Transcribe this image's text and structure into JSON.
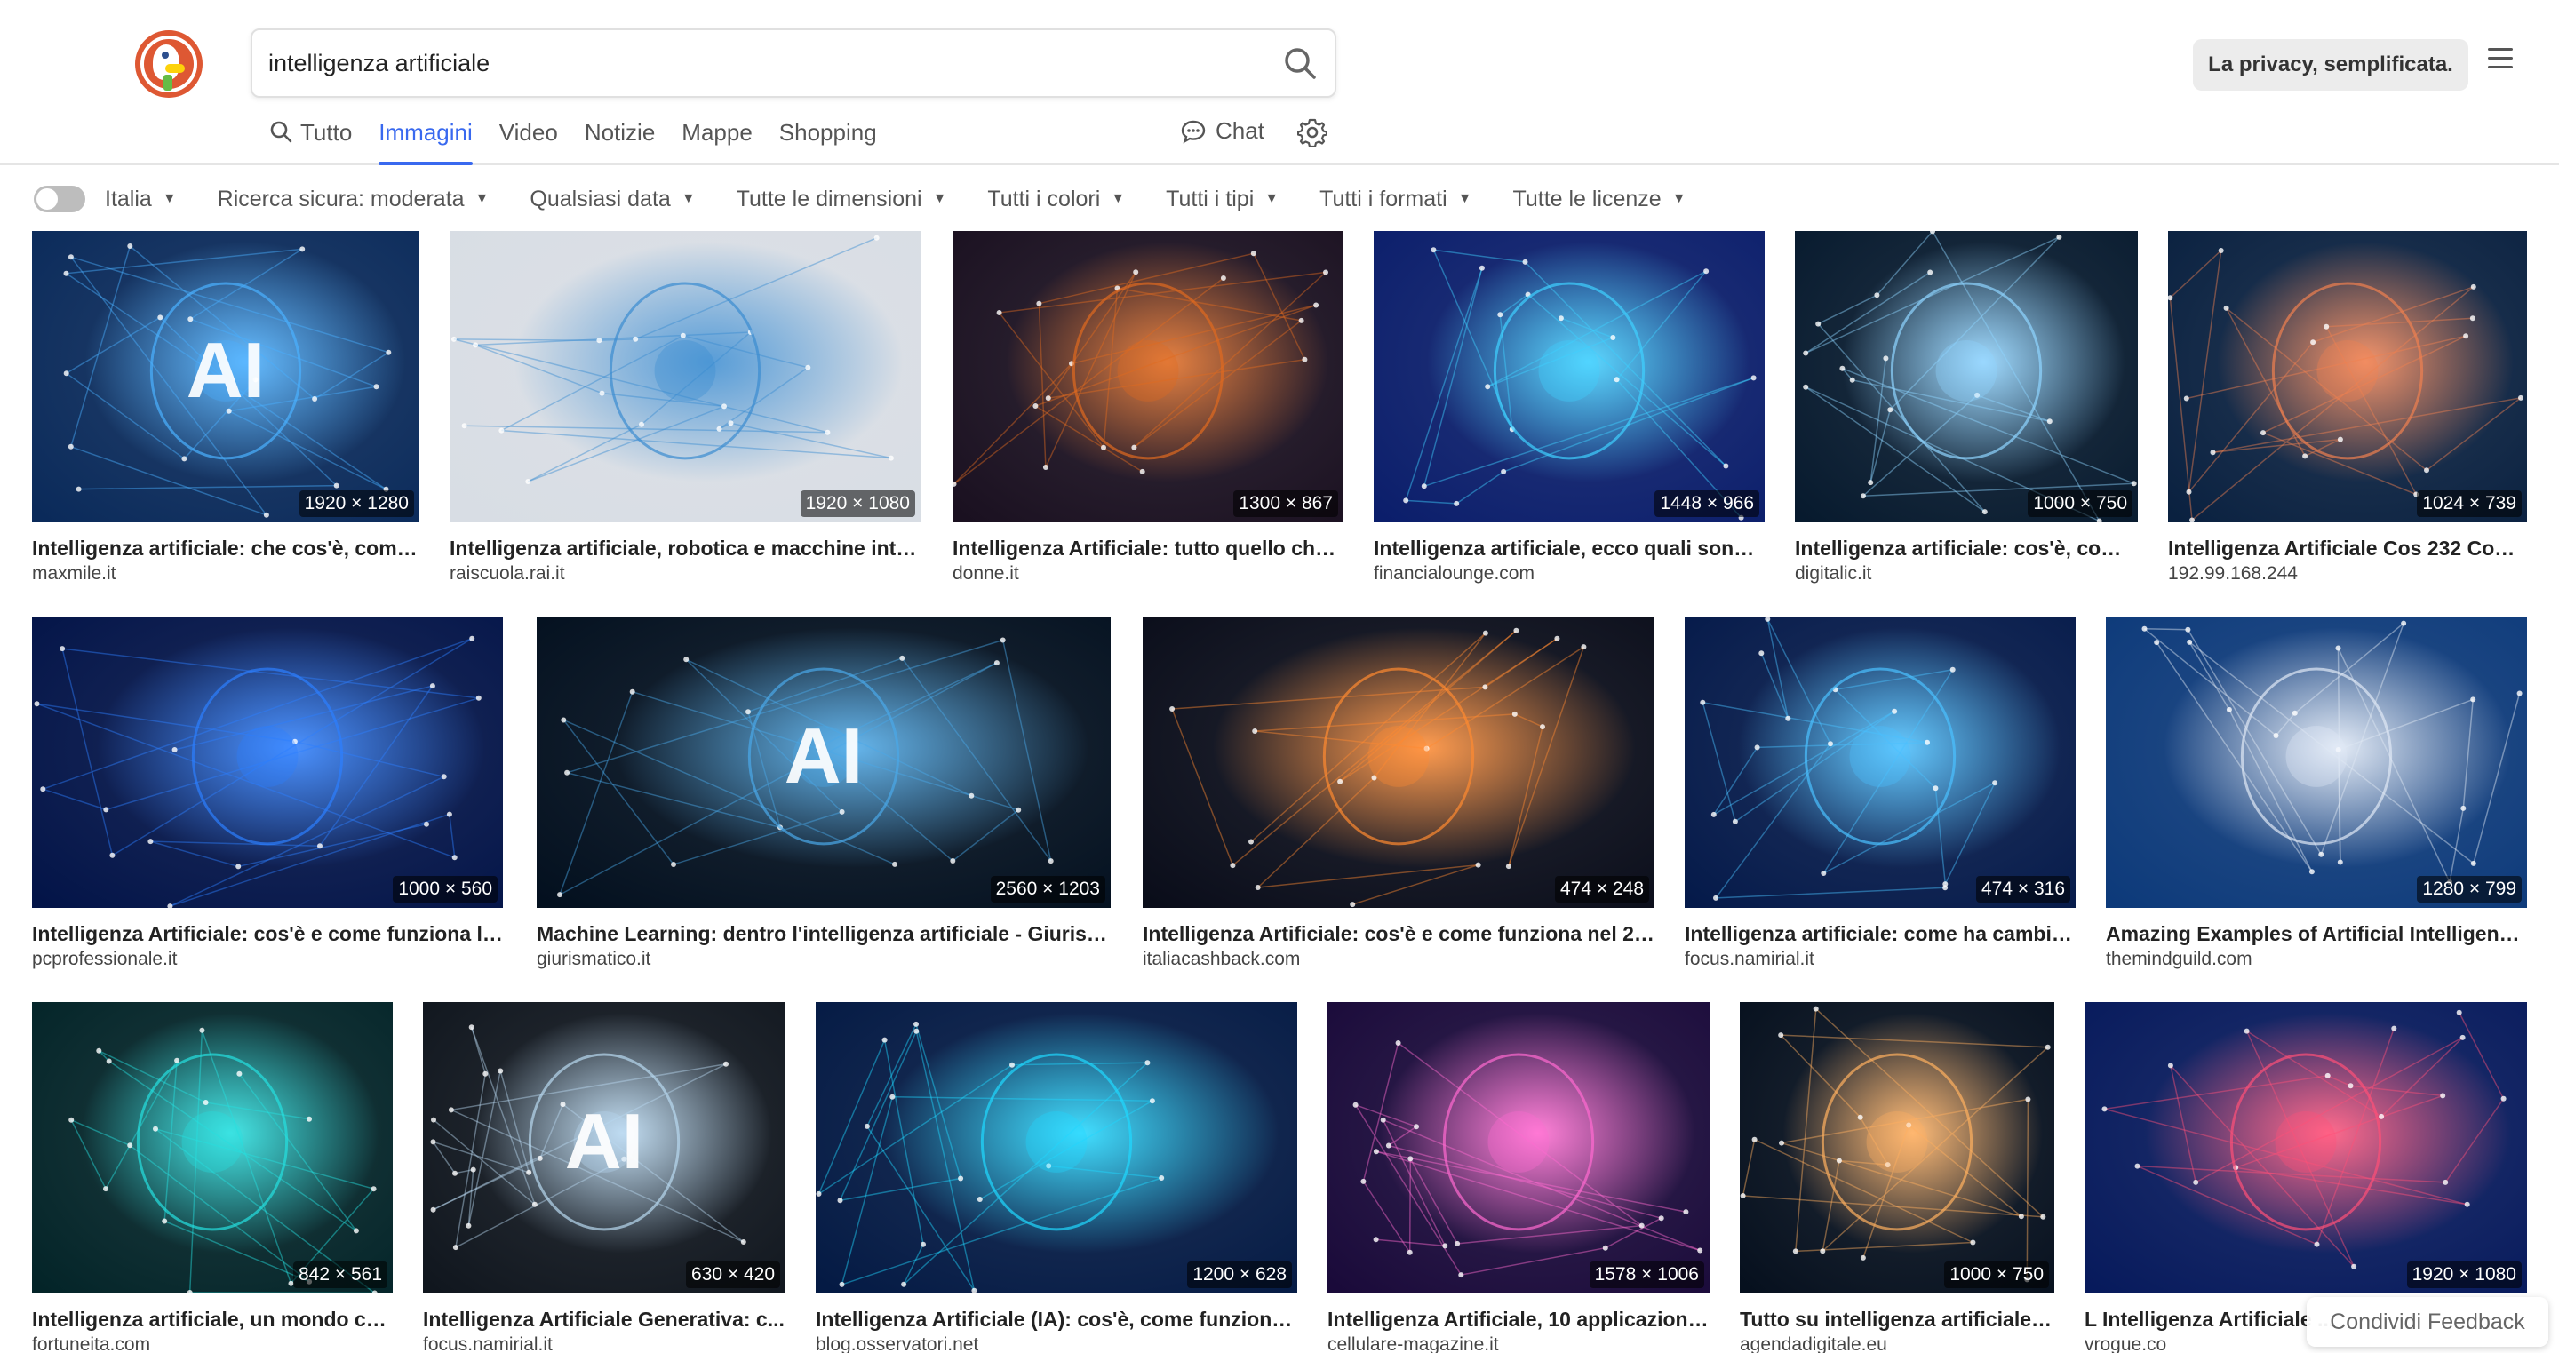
{
  "search": {
    "query": "intelligenza artificiale"
  },
  "header": {
    "privacy_label": "La privacy, semplificata."
  },
  "nav": {
    "tabs": [
      {
        "label": "Tutto",
        "active": false
      },
      {
        "label": "Immagini",
        "active": true
      },
      {
        "label": "Video",
        "active": false
      },
      {
        "label": "Notizie",
        "active": false
      },
      {
        "label": "Mappe",
        "active": false
      },
      {
        "label": "Shopping",
        "active": false
      }
    ],
    "chat_label": "Chat"
  },
  "filters": {
    "region": "Italia",
    "items": [
      "Ricerca sicura: moderata",
      "Qualsiasi data",
      "Tutte le dimensioni",
      "Tutti i colori",
      "Tutti i tipi",
      "Tutti i formati",
      "Tutte le licenze"
    ]
  },
  "results": [
    {
      "title": "Intelligenza artificiale: che cos'è, come ...",
      "source": "maxmile.it",
      "dims": "1920 × 1280",
      "colors": [
        "#0a2a5a",
        "#4ab0ff"
      ],
      "motif": "AI"
    },
    {
      "title": "Intelligenza artificiale, robotica e macchine intel...",
      "source": "raiscuola.rai.it",
      "dims": "1920 × 1080",
      "colors": [
        "#d8dde4",
        "#3a8bd0"
      ],
      "motif": ""
    },
    {
      "title": "Intelligenza Artificiale: tutto quello che ...",
      "source": "donne.it",
      "dims": "1300 × 867",
      "colors": [
        "#1a1020",
        "#e06a20"
      ],
      "motif": ""
    },
    {
      "title": "Intelligenza artificiale, ecco quali sono i...",
      "source": "financialounge.com",
      "dims": "1448 × 966",
      "colors": [
        "#0b1e6b",
        "#3fd0ff"
      ],
      "motif": ""
    },
    {
      "title": "Intelligenza artificiale: cos'è, come...",
      "source": "digitalic.it",
      "dims": "1000 × 750",
      "colors": [
        "#071a2e",
        "#8fd4ff"
      ],
      "motif": ""
    },
    {
      "title": "Intelligenza Artificiale Cos 232 Com...",
      "source": "192.99.168.244",
      "dims": "1024 × 739",
      "colors": [
        "#0a2140",
        "#f08050"
      ],
      "motif": ""
    },
    {
      "title": "Intelligenza Artificiale: cos'è e come funziona l'AI?",
      "source": "pcprofessionale.it",
      "dims": "1000 × 560",
      "colors": [
        "#031448",
        "#2c7fff"
      ],
      "motif": ""
    },
    {
      "title": "Machine Learning: dentro l'intelligenza artificiale - Giurism...",
      "source": "giurismatico.it",
      "dims": "2560 × 1203",
      "colors": [
        "#03101f",
        "#4aa8e8"
      ],
      "motif": "AI"
    },
    {
      "title": "Intelligenza Artificiale: cos'è e come funziona nel 20...",
      "source": "italiacashback.com",
      "dims": "474 × 248",
      "colors": [
        "#0a0d1a",
        "#ff8a30"
      ],
      "motif": ""
    },
    {
      "title": "Intelligenza artificiale: come ha cambiat...",
      "source": "focus.namirial.it",
      "dims": "474 × 316",
      "colors": [
        "#051a4a",
        "#4ac0ff"
      ],
      "motif": ""
    },
    {
      "title": "Amazing Examples of Artificial Intelligence...",
      "source": "themindguild.com",
      "dims": "1280 × 799",
      "colors": [
        "#0d3a7a",
        "#dfe8f5"
      ],
      "motif": ""
    },
    {
      "title": "Intelligenza artificiale, un mondo ch...",
      "source": "fortuneita.com",
      "dims": "842 × 561",
      "colors": [
        "#032428",
        "#25e0e0"
      ],
      "motif": ""
    },
    {
      "title": "Intelligenza Artificiale Generativa: c...",
      "source": "focus.namirial.it",
      "dims": "630 × 420",
      "colors": [
        "#10161e",
        "#b8d8f0"
      ],
      "motif": "AI"
    },
    {
      "title": "Intelligenza Artificiale (IA): cos'è, come funziona ...",
      "source": "blog.osservatori.net",
      "dims": "1200 × 628",
      "colors": [
        "#041a44",
        "#20d8ff"
      ],
      "motif": ""
    },
    {
      "title": "Intelligenza Artificiale, 10 applicazioni ...",
      "source": "cellulare-magazine.it",
      "dims": "1578 × 1006",
      "colors": [
        "#1a0a3a",
        "#ff6ad0"
      ],
      "motif": ""
    },
    {
      "title": "Tutto su intelligenza artificiale l...",
      "source": "agendadigitale.eu",
      "dims": "1000 × 750",
      "colors": [
        "#06101e",
        "#ffb060"
      ],
      "motif": ""
    },
    {
      "title": "L Intelligenza Artificiale ...",
      "source": "vrogue.co",
      "dims": "1920 × 1080",
      "colors": [
        "#071a5c",
        "#ff5078"
      ],
      "motif": ""
    }
  ],
  "feedback_label": "Condividi Feedback"
}
